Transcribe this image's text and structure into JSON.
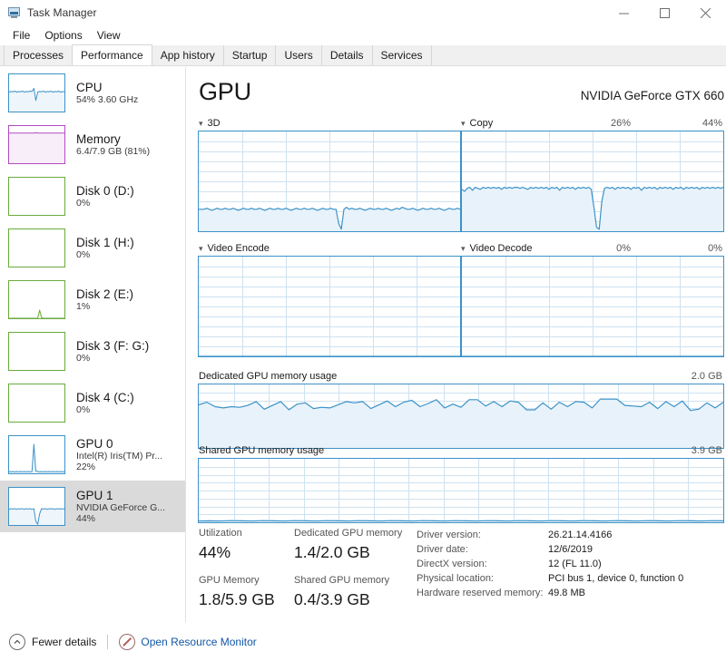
{
  "window": {
    "title": "Task Manager",
    "icon": "task-manager-icon",
    "minimize": "—",
    "maximize": "□",
    "close": "✕"
  },
  "menu": {
    "items": [
      {
        "label": "File"
      },
      {
        "label": "Options"
      },
      {
        "label": "View"
      }
    ]
  },
  "tabs": {
    "active": "Performance",
    "items": [
      {
        "label": "Processes"
      },
      {
        "label": "Performance"
      },
      {
        "label": "App history"
      },
      {
        "label": "Startup"
      },
      {
        "label": "Users"
      },
      {
        "label": "Details"
      },
      {
        "label": "Services"
      }
    ]
  },
  "sidebar": {
    "items": [
      {
        "title": "CPU",
        "sub": "54% 3.60 GHz",
        "sub2": "",
        "accent": "#3b92c8",
        "selected": false
      },
      {
        "title": "Memory",
        "sub": "6.4/7.9 GB (81%)",
        "sub2": "",
        "accent": "#b04cc0",
        "selected": false
      },
      {
        "title": "Disk 0 (D:)",
        "sub": "0%",
        "sub2": "",
        "accent": "#6aab3c",
        "selected": false
      },
      {
        "title": "Disk 1 (H:)",
        "sub": "0%",
        "sub2": "",
        "accent": "#6aab3c",
        "selected": false
      },
      {
        "title": "Disk 2 (E:)",
        "sub": "1%",
        "sub2": "",
        "accent": "#6aab3c",
        "selected": false
      },
      {
        "title": "Disk 3 (F: G:)",
        "sub": "0%",
        "sub2": "",
        "accent": "#6aab3c",
        "selected": false
      },
      {
        "title": "Disk 4 (C:)",
        "sub": "0%",
        "sub2": "",
        "accent": "#6aab3c",
        "selected": false
      },
      {
        "title": "GPU 0",
        "sub": "Intel(R) Iris(TM) Pr...",
        "sub2": "22%",
        "accent": "#3b92c8",
        "selected": false
      },
      {
        "title": "GPU 1",
        "sub": "NVIDIA GeForce G...",
        "sub2": "44%",
        "accent": "#3b92c8",
        "selected": true
      }
    ]
  },
  "main": {
    "heading": "GPU",
    "device_model": "NVIDIA GeForce GTX 660",
    "graphs": [
      {
        "label": "3D",
        "value": "26%",
        "collapsible": true
      },
      {
        "label": "Copy",
        "value": "44%",
        "collapsible": true
      },
      {
        "label": "Video Encode",
        "value": "0%",
        "collapsible": true
      },
      {
        "label": "Video Decode",
        "value": "0%",
        "collapsible": true
      }
    ],
    "memory_graphs": [
      {
        "label": "Dedicated GPU memory usage",
        "max": "2.0 GB"
      },
      {
        "label": "Shared GPU memory usage",
        "max": "3.9 GB"
      }
    ],
    "stats": [
      {
        "label": "Utilization",
        "value": "44%"
      },
      {
        "label": "Dedicated GPU memory",
        "value": "1.4/2.0 GB"
      },
      {
        "label": "GPU Memory",
        "value": "1.8/5.9 GB"
      },
      {
        "label": "Shared GPU memory",
        "value": "0.4/3.9 GB"
      }
    ],
    "info": [
      {
        "label": "Driver version:",
        "value": "26.21.14.4166"
      },
      {
        "label": "Driver date:",
        "value": "12/6/2019"
      },
      {
        "label": "DirectX version:",
        "value": "12 (FL 11.0)"
      },
      {
        "label": "Physical location:",
        "value": "PCI bus 1, device 0, function 0"
      },
      {
        "label": "Hardware reserved memory:",
        "value": "49.8 MB"
      }
    ]
  },
  "footer": {
    "fewer_details": "Fewer details",
    "resource_monitor": "Open Resource Monitor"
  },
  "chart_data": [
    {
      "type": "line",
      "title": "3D",
      "ylabel": "utilization %",
      "ylim": [
        0,
        100
      ],
      "current": 26,
      "values": [
        22,
        22,
        22,
        23,
        22,
        21,
        22,
        23,
        22,
        22,
        23,
        22,
        22,
        23,
        22,
        21,
        22,
        23,
        22,
        22,
        23,
        22,
        22,
        23,
        22,
        21,
        22,
        23,
        22,
        22,
        23,
        22,
        22,
        23,
        22,
        21,
        22,
        23,
        22,
        22,
        23,
        22,
        22,
        23,
        22,
        21,
        22,
        23,
        22,
        22,
        23,
        22,
        22,
        8,
        2,
        22,
        24,
        22,
        23,
        22,
        22,
        23,
        22,
        21,
        22,
        23,
        22,
        22,
        23,
        22,
        22,
        23,
        22,
        21,
        22,
        23,
        22,
        24,
        23,
        22,
        22,
        23,
        22,
        21,
        22,
        23,
        22,
        22,
        23,
        22,
        22,
        23,
        22,
        21,
        22,
        23,
        22,
        22,
        23,
        22
      ]
    },
    {
      "type": "line",
      "title": "Copy",
      "ylabel": "utilization %",
      "ylim": [
        0,
        100
      ],
      "current": 44,
      "values": [
        42,
        40,
        43,
        44,
        41,
        44,
        43,
        42,
        44,
        43,
        44,
        43,
        44,
        43,
        44,
        42,
        44,
        43,
        44,
        43,
        44,
        44,
        43,
        44,
        43,
        42,
        44,
        43,
        44,
        43,
        44,
        43,
        44,
        42,
        44,
        43,
        44,
        41,
        44,
        43,
        44,
        43,
        44,
        42,
        44,
        43,
        44,
        43,
        44,
        42,
        24,
        4,
        2,
        30,
        43,
        44,
        43,
        44,
        42,
        44,
        43,
        44,
        43,
        44,
        42,
        44,
        43,
        44,
        41,
        44,
        43,
        44,
        43,
        44,
        42,
        44,
        43,
        44,
        43,
        44,
        42,
        44,
        43,
        44,
        42,
        44,
        43,
        44,
        43,
        44,
        42,
        44,
        43,
        44,
        43,
        44,
        43,
        44,
        43,
        44
      ]
    },
    {
      "type": "line",
      "title": "Video Encode",
      "ylabel": "utilization %",
      "ylim": [
        0,
        100
      ],
      "current": 0,
      "values": [
        0,
        0,
        0,
        0,
        0,
        0,
        0,
        0,
        0,
        0,
        0,
        0,
        0,
        0,
        0,
        0,
        0,
        0,
        0,
        0,
        0,
        0,
        0,
        0,
        0,
        0,
        0,
        0,
        0,
        0,
        0,
        0,
        0,
        0,
        0,
        0,
        0,
        0,
        0,
        0,
        0,
        0,
        0,
        0,
        0,
        0,
        0,
        0,
        0,
        0
      ]
    },
    {
      "type": "line",
      "title": "Video Decode",
      "ylabel": "utilization %",
      "ylim": [
        0,
        100
      ],
      "current": 0,
      "values": [
        0,
        0,
        0,
        0,
        0,
        0,
        0,
        0,
        0,
        0,
        0,
        0,
        0,
        0,
        0,
        0,
        0,
        0,
        0,
        0,
        0,
        0,
        0,
        0,
        0,
        0,
        0,
        0,
        0,
        0,
        0,
        0,
        0,
        0,
        0,
        0,
        0,
        0,
        0,
        0,
        0,
        0,
        0,
        0,
        0,
        0,
        0,
        0,
        0,
        0
      ]
    },
    {
      "type": "area",
      "title": "Dedicated GPU memory usage",
      "ylabel": "GB",
      "ylim": [
        0,
        2.0
      ],
      "current": 1.4,
      "values": [
        1.36,
        1.44,
        1.3,
        1.26,
        1.3,
        1.28,
        1.34,
        1.46,
        1.22,
        1.34,
        1.46,
        1.2,
        1.38,
        1.42,
        1.24,
        1.28,
        1.26,
        1.36,
        1.46,
        1.42,
        1.46,
        1.24,
        1.36,
        1.48,
        1.3,
        1.44,
        1.5,
        1.3,
        1.4,
        1.52,
        1.26,
        1.38,
        1.28,
        1.52,
        1.52,
        1.32,
        1.46,
        1.3,
        1.48,
        1.44,
        1.2,
        1.2,
        1.42,
        1.22,
        1.44,
        1.3,
        1.46,
        1.44,
        1.26,
        1.54,
        1.54,
        1.54,
        1.34,
        1.32,
        1.3,
        1.44,
        1.24,
        1.46,
        1.3,
        1.48,
        1.18,
        1.22,
        1.42,
        1.26,
        1.44
      ]
    },
    {
      "type": "area",
      "title": "Shared GPU memory usage",
      "ylabel": "GB",
      "ylim": [
        0,
        3.9
      ],
      "current": 0.4,
      "values": [
        0.08,
        0.09,
        0.08,
        0.1,
        0.09,
        0.08,
        0.1,
        0.09,
        0.08,
        0.1,
        0.09,
        0.08,
        0.1,
        0.09,
        0.08,
        0.1,
        0.09,
        0.08,
        0.1,
        0.09,
        0.08,
        0.1,
        0.09,
        0.08,
        0.1,
        0.09,
        0.08,
        0.1,
        0.09,
        0.08,
        0.1,
        0.09,
        0.08,
        0.1,
        0.09,
        0.08,
        0.1,
        0.09,
        0.08,
        0.1,
        0.09,
        0.08,
        0.1,
        0.09,
        0.08,
        0.1,
        0.09,
        0.08,
        0.1,
        0.09
      ]
    },
    {
      "type": "line",
      "title": "CPU thumbnail",
      "ylim": [
        0,
        100
      ],
      "current": 54,
      "values": [
        52,
        54,
        53,
        55,
        52,
        54,
        53,
        55,
        52,
        54,
        53,
        55,
        54,
        62,
        30,
        52,
        54,
        53,
        55,
        52,
        54,
        53,
        55,
        52,
        54,
        53,
        55,
        52,
        54,
        53
      ]
    },
    {
      "type": "line",
      "title": "Memory thumbnail",
      "ylim": [
        0,
        100
      ],
      "current": 81,
      "values": [
        81,
        81,
        81,
        81,
        81,
        81,
        81,
        81,
        81,
        81,
        81,
        81,
        81,
        81,
        82,
        81,
        81,
        81,
        81,
        81,
        81,
        81,
        81,
        81,
        81,
        81,
        81,
        81,
        81,
        81
      ]
    },
    {
      "type": "line",
      "title": "GPU 0 thumbnail",
      "ylim": [
        0,
        100
      ],
      "current": 22,
      "values": [
        5,
        4,
        5,
        4,
        5,
        4,
        5,
        4,
        5,
        4,
        5,
        4,
        5,
        78,
        6,
        5,
        4,
        5,
        4,
        5,
        4,
        5,
        4,
        5,
        4,
        5,
        4,
        5,
        4,
        5
      ]
    },
    {
      "type": "line",
      "title": "GPU 1 thumbnail",
      "ylim": [
        0,
        100
      ],
      "current": 44,
      "values": [
        42,
        44,
        43,
        44,
        42,
        44,
        43,
        44,
        42,
        44,
        43,
        44,
        42,
        44,
        10,
        2,
        30,
        44,
        43,
        44,
        42,
        44,
        43,
        44,
        42,
        44,
        43,
        44,
        43,
        44
      ]
    },
    {
      "type": "line",
      "title": "Disk 2 thumbnail",
      "ylim": [
        0,
        100
      ],
      "current": 1,
      "values": [
        0,
        0,
        0,
        0,
        0,
        0,
        0,
        0,
        0,
        0,
        0,
        0,
        0,
        0,
        0,
        0,
        22,
        2,
        0,
        0,
        0,
        0,
        0,
        0,
        0,
        0,
        0,
        0,
        0,
        0
      ]
    }
  ]
}
